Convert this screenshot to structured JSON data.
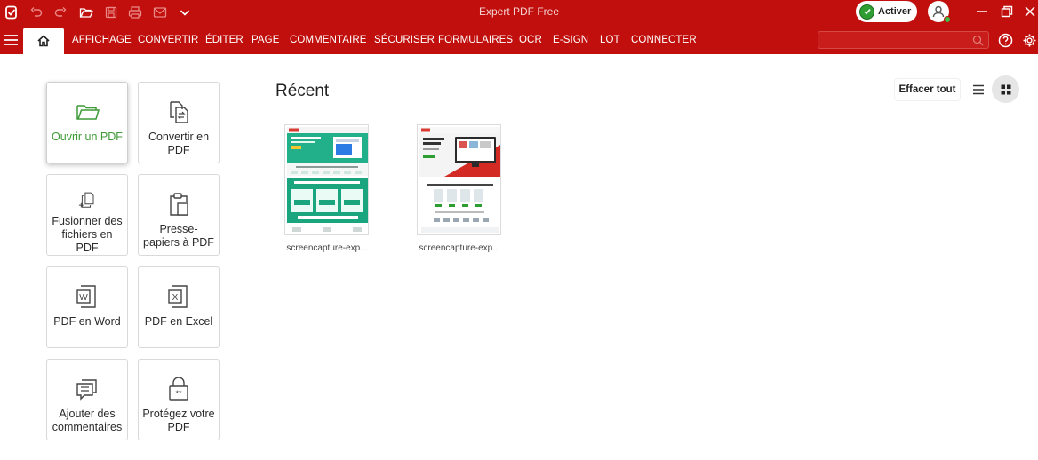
{
  "titlebar": {
    "app_title": "Expert PDF Free",
    "activate_label": "Activer",
    "icons": [
      "app-logo-icon",
      "undo-icon",
      "redo-icon",
      "open-folder-icon",
      "save-icon",
      "print-icon",
      "email-icon",
      "chevron-down-icon"
    ]
  },
  "menu": {
    "items": [
      "AFFICHAGE",
      "CONVERTIR",
      "ÉDITER",
      "PAGE",
      "COMMENTAIRE",
      "SÉCURISER",
      "FORMULAIRES",
      "OCR",
      "E-SIGN",
      "LOT",
      "CONNECTER"
    ],
    "search_value": ""
  },
  "tools": [
    {
      "label": "Ouvrir un PDF",
      "icon": "folder-open-icon"
    },
    {
      "label": "Convertir en PDF",
      "icon": "convert-icon"
    },
    {
      "label": "Fusionner des fichiers en PDF",
      "icon": "merge-icon"
    },
    {
      "label": "Presse-papiers à PDF",
      "icon": "clipboard-icon"
    },
    {
      "label": "PDF en Word",
      "icon": "word-icon"
    },
    {
      "label": "PDF en Excel",
      "icon": "excel-icon"
    },
    {
      "label": "Ajouter des commentaires",
      "icon": "comment-icon"
    },
    {
      "label": "Protégez votre PDF",
      "icon": "lock-icon"
    }
  ],
  "recent": {
    "title": "Récent",
    "clear_label": "Effacer tout",
    "files": [
      {
        "name": "screencapture-exp..."
      },
      {
        "name": "screencapture-exp..."
      }
    ]
  },
  "colors": {
    "brand_red": "#c00f0c",
    "accent_green": "#3d9a36"
  }
}
